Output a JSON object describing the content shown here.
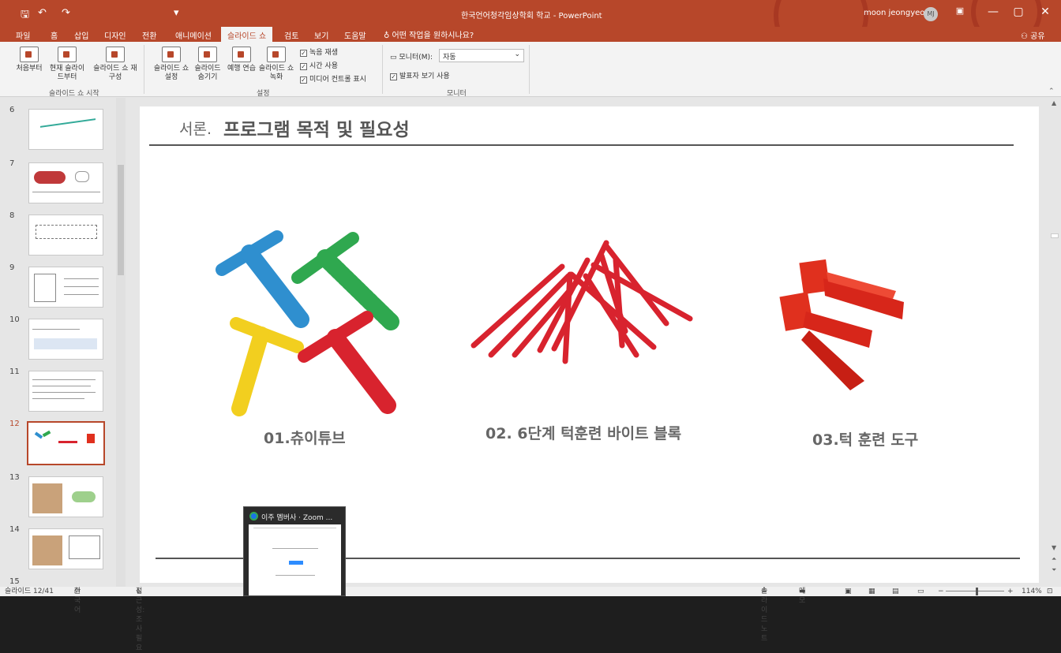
{
  "window": {
    "doc_title": "한국언어청각임상학회 학교 - PowerPoint",
    "user_name": "moon jeongyeon",
    "user_initials": "MJ",
    "buttons": [
      "—",
      "▢",
      "✕"
    ],
    "ribbon_display_icon": "ribbon-display-icon"
  },
  "quick_access": {
    "save_icon": "save-icon",
    "undo_icon": "undo-icon",
    "redo_icon": "redo-icon",
    "customize_icon": "customize-icon"
  },
  "tabs": [
    {
      "label": "파일"
    },
    {
      "label": "홈"
    },
    {
      "label": "삽입"
    },
    {
      "label": "디자인"
    },
    {
      "label": "전환"
    },
    {
      "label": "애니메이션"
    },
    {
      "label": "슬라이드 쇼",
      "active": true
    },
    {
      "label": "검토"
    },
    {
      "label": "보기"
    },
    {
      "label": "도움말"
    }
  ],
  "tell_me": "어떤 작업을 원하시나요?",
  "share": "공유",
  "ribbon": {
    "start_group": {
      "label": "슬라이드 쇼 시작",
      "from_beginning": "처음부터",
      "from_current": "현재 슬라이드부터",
      "custom": "슬라이드 쇼 재구성"
    },
    "setup_group": {
      "label": "설정",
      "setup_show": "슬라이드 쇼 설정",
      "hide_slide": "슬라이드 숨기기",
      "rehearse": "예행 연습",
      "record": "슬라이드 쇼 녹화",
      "play_narration": "녹음 재생",
      "use_timings": "시간 사용",
      "show_media_controls": "미디어 컨트롤 표시"
    },
    "monitor_group": {
      "label": "모니터",
      "monitor_label": "모니터(M):",
      "monitor_value": "자동",
      "presenter_view": "발표자 보기 사용"
    }
  },
  "thumbnails": [
    {
      "num": "6"
    },
    {
      "num": "7"
    },
    {
      "num": "8"
    },
    {
      "num": "9"
    },
    {
      "num": "10"
    },
    {
      "num": "11"
    },
    {
      "num": "12",
      "active": true
    },
    {
      "num": "13"
    },
    {
      "num": "14"
    },
    {
      "num": "15"
    }
  ],
  "slide": {
    "title_prefix": "서론.",
    "title_main": "프로그램 목적 및 필요성",
    "captions": [
      "01.츄이튜브",
      "02. 6단계 턱훈련 바이트 블록",
      "03.턱 훈련 도구"
    ]
  },
  "popup": {
    "title": "이주 멤버사 · Zoom ..."
  },
  "statusbar": {
    "slide_info": "슬라이드 12/41",
    "language": "한국어",
    "accessibility": "접근성: 조사 필요",
    "notes": "슬라이드 노트",
    "comments": "메모",
    "zoom": "114%"
  },
  "colors": {
    "accent": "#b7472a",
    "blue_tube": "#2f8fcf",
    "green_tube": "#2fa84f",
    "yellow_tube": "#f2cf1f",
    "red_tube": "#d8232e"
  }
}
